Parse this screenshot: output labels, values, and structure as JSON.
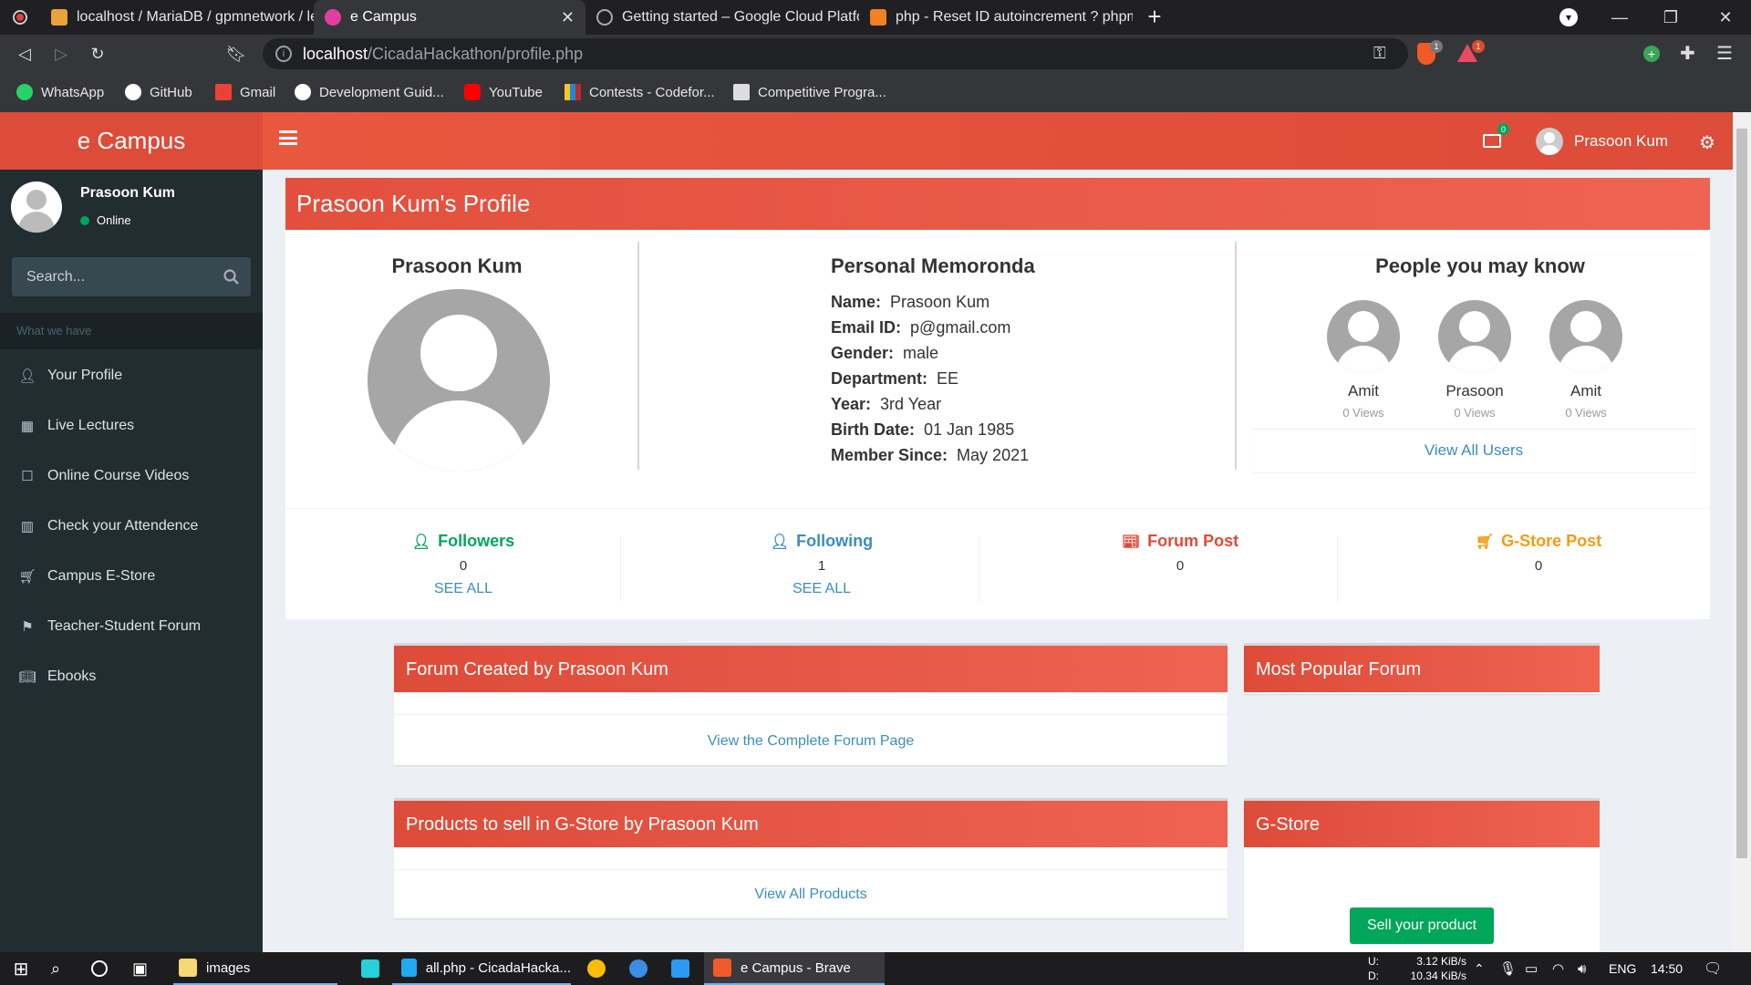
{
  "browser": {
    "tabs": [
      {
        "title": "localhost / MariaDB / gpmnetwork / le"
      },
      {
        "title": "e Campus"
      },
      {
        "title": "Getting started – Google Cloud Platfor"
      },
      {
        "title": "php - Reset ID autoincrement ? phpmy"
      }
    ],
    "url_host": "localhost",
    "url_path": "/CicadaHackathon/profile.php",
    "bookmarks": [
      {
        "label": "WhatsApp"
      },
      {
        "label": "GitHub"
      },
      {
        "label": "Gmail"
      },
      {
        "label": "Development Guid..."
      },
      {
        "label": "YouTube"
      },
      {
        "label": "Contests - Codefor..."
      },
      {
        "label": "Competitive Progra..."
      }
    ],
    "brave_badge": "1",
    "rewards_badge": "1"
  },
  "app": {
    "logo": "e Campus",
    "mail_count": "0",
    "user_name": "Prasoon Kum"
  },
  "sidebar": {
    "user_name": "Prasoon Kum",
    "status": "Online",
    "search_placeholder": "Search...",
    "header": "What we have",
    "items": [
      {
        "label": "Your Profile",
        "icon": "user-icon"
      },
      {
        "label": "Live Lectures",
        "icon": "calendar-icon"
      },
      {
        "label": "Online Course Videos",
        "icon": "square-icon"
      },
      {
        "label": "Check your Attendence",
        "icon": "bar-chart-icon"
      },
      {
        "label": "Campus E-Store",
        "icon": "cart-icon"
      },
      {
        "label": "Teacher-Student Forum",
        "icon": "flag-icon"
      },
      {
        "label": "Ebooks",
        "icon": "book-icon"
      }
    ]
  },
  "profile": {
    "title": "Prasoon Kum's Profile",
    "name": "Prasoon Kum",
    "memo_title": "Personal Memoronda",
    "memo": [
      {
        "label": "Name:",
        "value": "Prasoon Kum"
      },
      {
        "label": "Email ID:",
        "value": "p@gmail.com"
      },
      {
        "label": "Gender:",
        "value": "male"
      },
      {
        "label": "Department:",
        "value": "EE"
      },
      {
        "label": "Year:",
        "value": "3rd Year"
      },
      {
        "label": "Birth Date:",
        "value": "01 Jan 1985"
      },
      {
        "label": "Member Since:",
        "value": "May 2021"
      }
    ],
    "pymk_title": "People you may know",
    "people": [
      {
        "name": "Amit",
        "views": "0 Views"
      },
      {
        "name": "Prasoon",
        "views": "0 Views"
      },
      {
        "name": "Amit",
        "views": "0 Views"
      }
    ],
    "view_all_users": "View All Users",
    "stats": [
      {
        "label": "Followers",
        "count": "0",
        "link": "SEE ALL",
        "color": "#00a65a"
      },
      {
        "label": "Following",
        "count": "1",
        "link": "SEE ALL",
        "color": "#3c8dbc"
      },
      {
        "label": "Forum Post",
        "count": "0",
        "link": "",
        "color": "#dd4b39"
      },
      {
        "label": "G-Store Post",
        "count": "0",
        "link": "",
        "color": "#f39c12"
      }
    ]
  },
  "boxes": {
    "forum_title": "Forum Created by Prasoon Kum",
    "forum_link": "View the Complete Forum Page",
    "popular_title": "Most Popular Forum",
    "products_title": "Products to sell in G-Store by Prasoon Kum",
    "products_link": "View All Products",
    "gstore_title": "G-Store",
    "sell_button": "Sell your product"
  },
  "taskbar": {
    "items": [
      {
        "label": "images"
      },
      {
        "label": "all.php - CicadaHacka..."
      },
      {
        "label": "e Campus - Brave"
      }
    ],
    "net_up": "3.12 KiB/s",
    "net_down": "10.34 KiB/s",
    "net_up_label": "U:",
    "net_down_label": "D:",
    "lang": "ENG",
    "time": "14:50"
  }
}
